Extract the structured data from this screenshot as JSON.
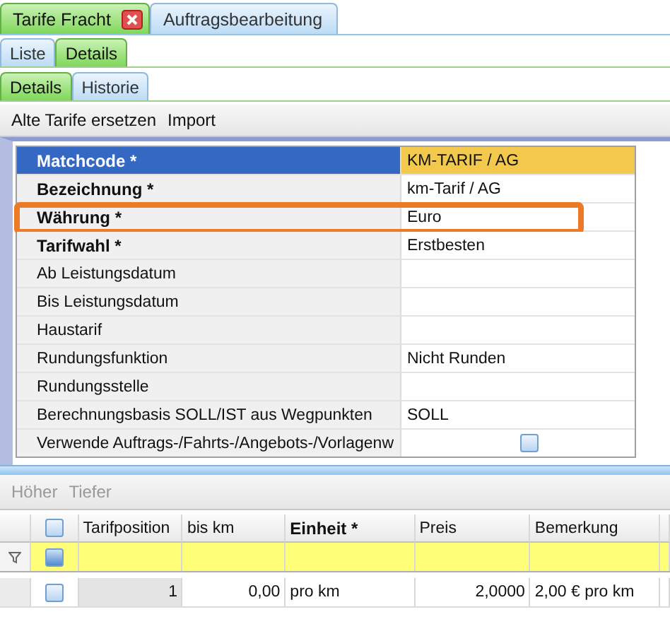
{
  "main_tabs": [
    {
      "label": "Tarife Fracht",
      "selected": true,
      "closable": true
    },
    {
      "label": "Auftragsbearbeitung",
      "selected": false,
      "closable": false
    }
  ],
  "view_tabs": [
    {
      "label": "Liste",
      "selected": false
    },
    {
      "label": "Details",
      "selected": true
    }
  ],
  "detail_tabs": [
    {
      "label": "Details",
      "selected": true
    },
    {
      "label": "Historie",
      "selected": false
    }
  ],
  "toolbar": [
    {
      "label": "Alte Tarife ersetzen",
      "disabled": false
    },
    {
      "label": "Import",
      "disabled": false
    }
  ],
  "properties": [
    {
      "kind": "text",
      "label": "Matchcode *",
      "value": "KM-TARIF / AG",
      "required": true,
      "selected": true,
      "highlighted": false
    },
    {
      "kind": "text",
      "label": "Bezeichnung *",
      "value": "km-Tarif / AG",
      "required": true,
      "selected": false,
      "highlighted": false
    },
    {
      "kind": "text",
      "label": "Währung *",
      "value": "Euro",
      "required": true,
      "selected": false,
      "highlighted": true
    },
    {
      "kind": "text",
      "label": "Tarifwahl *",
      "value": "Erstbesten",
      "required": true,
      "selected": false,
      "highlighted": false
    },
    {
      "kind": "text",
      "label": "Ab Leistungsdatum",
      "required": false,
      "selected": false,
      "highlighted": false
    },
    {
      "kind": "text",
      "label": "Bis Leistungsdatum",
      "required": false,
      "selected": false,
      "highlighted": false
    },
    {
      "kind": "text",
      "label": "Haustarif",
      "required": false,
      "selected": false,
      "highlighted": false
    },
    {
      "kind": "text",
      "label": "Rundungsfunktion",
      "value": "Nicht Runden",
      "required": false,
      "selected": false,
      "highlighted": false
    },
    {
      "kind": "text",
      "label": "Rundungsstelle",
      "required": false,
      "selected": false,
      "highlighted": false
    },
    {
      "kind": "text",
      "label": "Berechnungsbasis SOLL/IST aus Wegpunkten",
      "value": "SOLL",
      "required": false,
      "selected": false,
      "highlighted": false
    },
    {
      "kind": "checkbox",
      "label": "Verwende Auftrags-/Fahrts-/Angebots-/Vorlagenw",
      "checked": false,
      "required": false,
      "selected": false,
      "highlighted": false
    }
  ],
  "position_toolbar": [
    {
      "label": "Höher",
      "disabled": true
    },
    {
      "label": "Tiefer",
      "disabled": true
    }
  ],
  "table": {
    "select_all_checked": false,
    "filter_checked": true,
    "columns": [
      {
        "label": "Tarifposition",
        "required": false,
        "numeric": true,
        "readonly": true
      },
      {
        "label": "bis km",
        "required": false,
        "numeric": true,
        "readonly": false
      },
      {
        "label": "Einheit *",
        "required": true,
        "numeric": false,
        "readonly": false
      },
      {
        "label": "Preis",
        "required": false,
        "numeric": true,
        "readonly": false
      },
      {
        "label": "Bemerkung",
        "required": false,
        "numeric": false,
        "readonly": false
      }
    ],
    "rows": [
      {
        "checked": false,
        "cells": [
          "1",
          "0,00",
          "pro km",
          "2,0000",
          "2,00 € pro km"
        ]
      }
    ]
  }
}
